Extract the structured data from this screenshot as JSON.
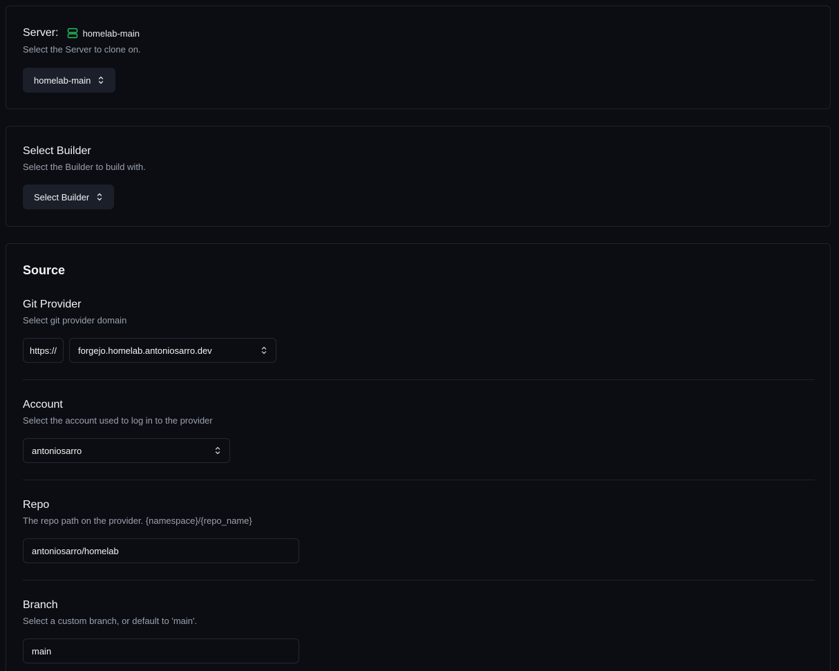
{
  "server": {
    "title": "Server:",
    "current": "homelab-main",
    "description": "Select the Server to clone on.",
    "select_label": "homelab-main",
    "icon": "server-icon",
    "icon_color": "#22c55e"
  },
  "builder": {
    "title": "Select Builder",
    "description": "Select the Builder to build with.",
    "select_label": "Select Builder"
  },
  "source": {
    "title": "Source",
    "git_provider": {
      "label": "Git Provider",
      "description": "Select git provider domain",
      "prefix": "https://",
      "domain": "forgejo.homelab.antoniosarro.dev"
    },
    "account": {
      "label": "Account",
      "description": "Select the account used to log in to the provider",
      "value": "antoniosarro"
    },
    "repo": {
      "label": "Repo",
      "description": "The repo path on the provider. {namespace}/{repo_name}",
      "value": "antoniosarro/homelab"
    },
    "branch": {
      "label": "Branch",
      "description": "Select a custom branch, or default to 'main'.",
      "value": "main"
    }
  }
}
